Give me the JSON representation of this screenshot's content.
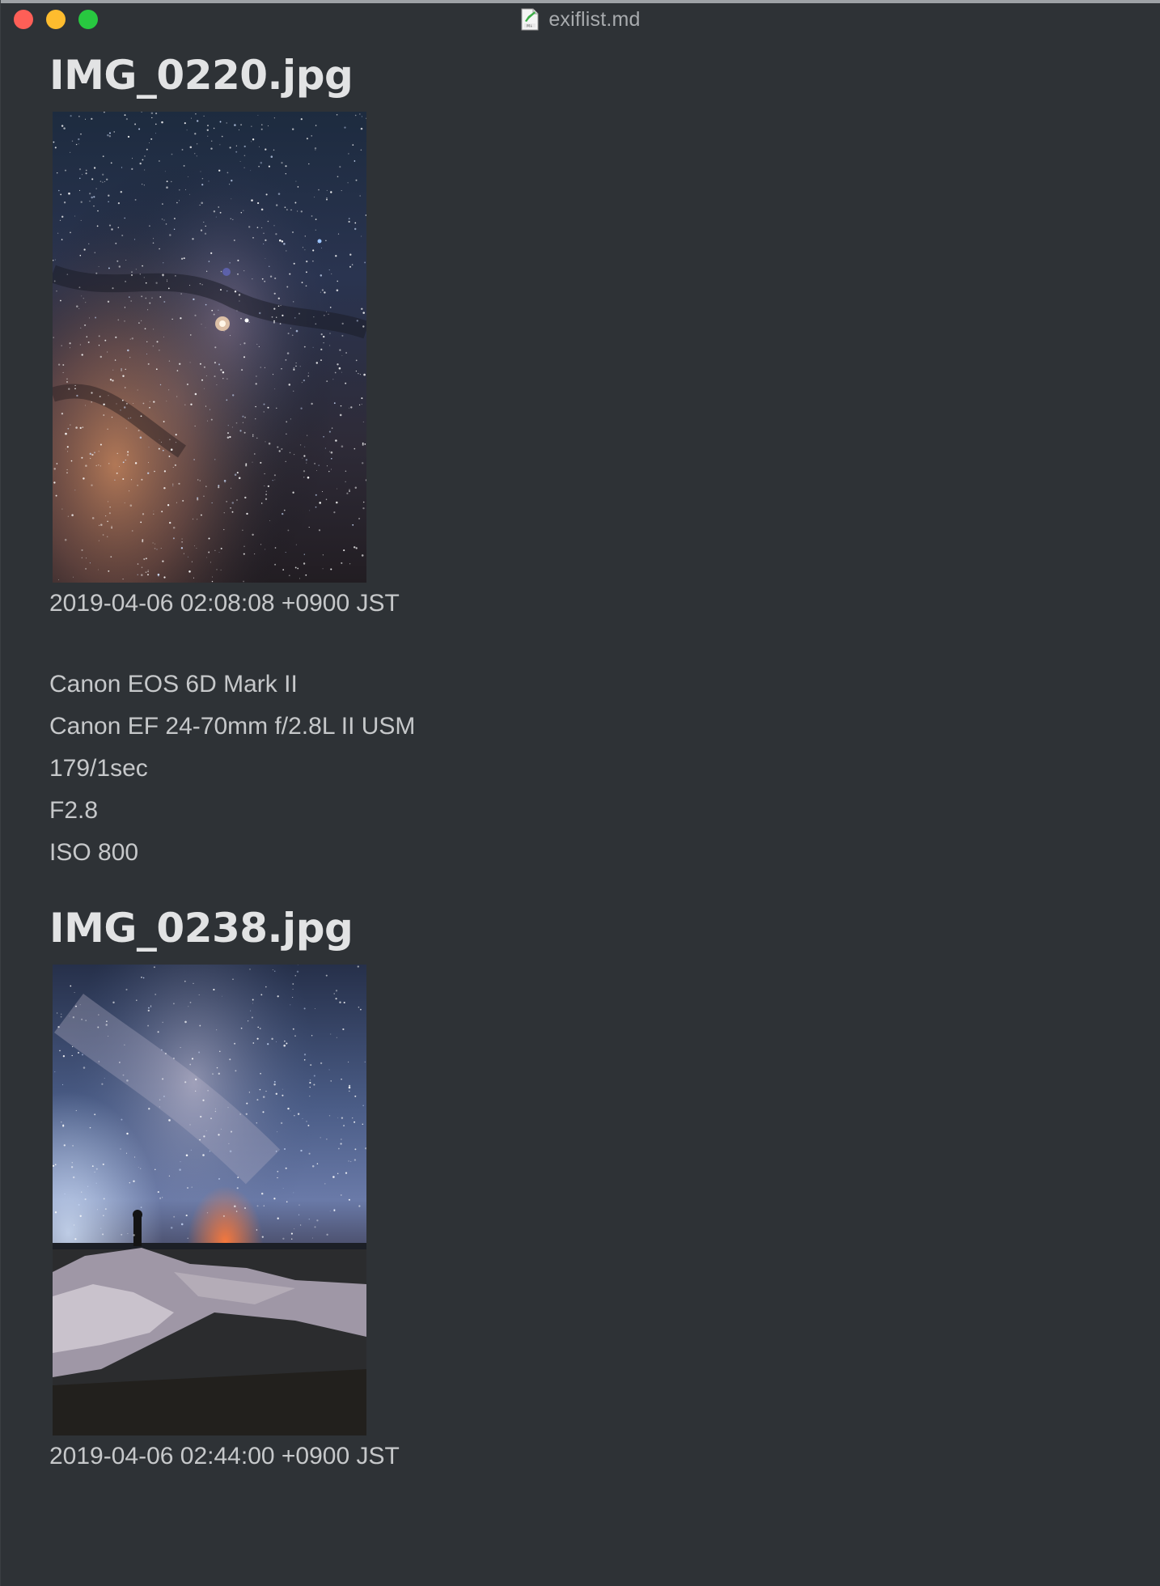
{
  "window": {
    "title": "exiflist.md",
    "title_icon": "markdown-document-icon"
  },
  "entries": [
    {
      "filename": "IMG_0220.jpg",
      "photo": "milky-way-core-starfield-photo",
      "datetime": "2019-04-06 02:08:08 +0900 JST",
      "camera": "Canon EOS 6D Mark II",
      "lens": "Canon EF 24-70mm f/2.8L II USM",
      "shutter": "179/1sec",
      "aperture": "F2.8",
      "iso": "ISO 800"
    },
    {
      "filename": "IMG_0238.jpg",
      "photo": "milky-way-over-rocky-shore-with-silhouette-photo",
      "datetime": "2019-04-06 02:44:00 +0900 JST"
    }
  ],
  "colors": {
    "background": "#2e3236",
    "heading": "#e2e3e4",
    "text": "#c6c8ca",
    "close": "#fe5f57",
    "minimize": "#febc2e",
    "maximize": "#28c840"
  }
}
